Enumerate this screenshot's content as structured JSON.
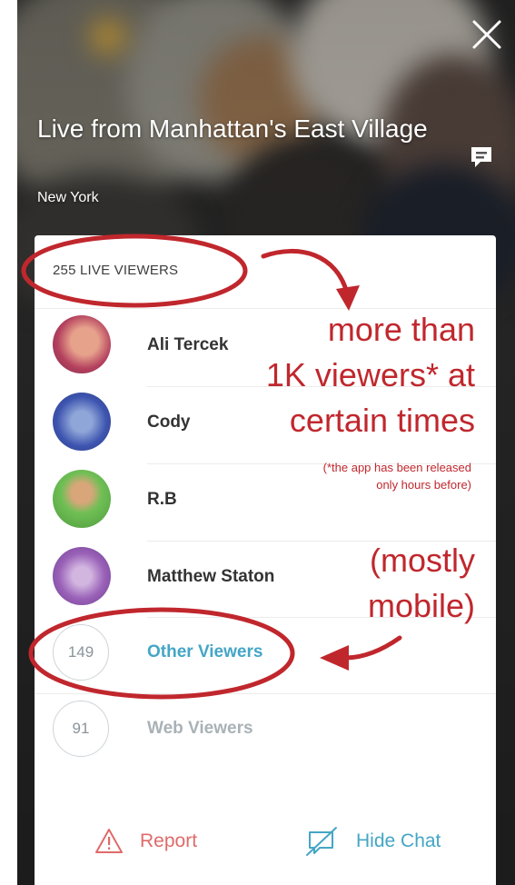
{
  "stream": {
    "title": "Live from Manhattan's East Village",
    "location": "New York"
  },
  "viewers_panel": {
    "header": "255 LIVE VIEWERS",
    "viewers": [
      {
        "name": "Ali Tercek"
      },
      {
        "name": "Cody"
      },
      {
        "name": "R.B"
      },
      {
        "name": "Matthew Staton"
      }
    ],
    "other_viewers": {
      "count": "149",
      "label": "Other Viewers"
    },
    "web_viewers": {
      "count": "91",
      "label": "Web Viewers"
    }
  },
  "actions": {
    "report_label": "Report",
    "hide_chat_label": "Hide Chat"
  },
  "annotations": {
    "line1": "more than",
    "line2": "1K viewers* at",
    "line3": "certain times",
    "footnote1": "(*the app has been released",
    "footnote2": "only hours before)",
    "mostly1": "(mostly",
    "mostly2": "mobile)"
  },
  "colors": {
    "annotation_red": "#c0272d",
    "link_blue": "#44a6c6",
    "report_red": "#e06a6a"
  },
  "icons": [
    "close-icon",
    "chat-bubble-icon",
    "warning-triangle-icon",
    "hide-chat-icon"
  ]
}
